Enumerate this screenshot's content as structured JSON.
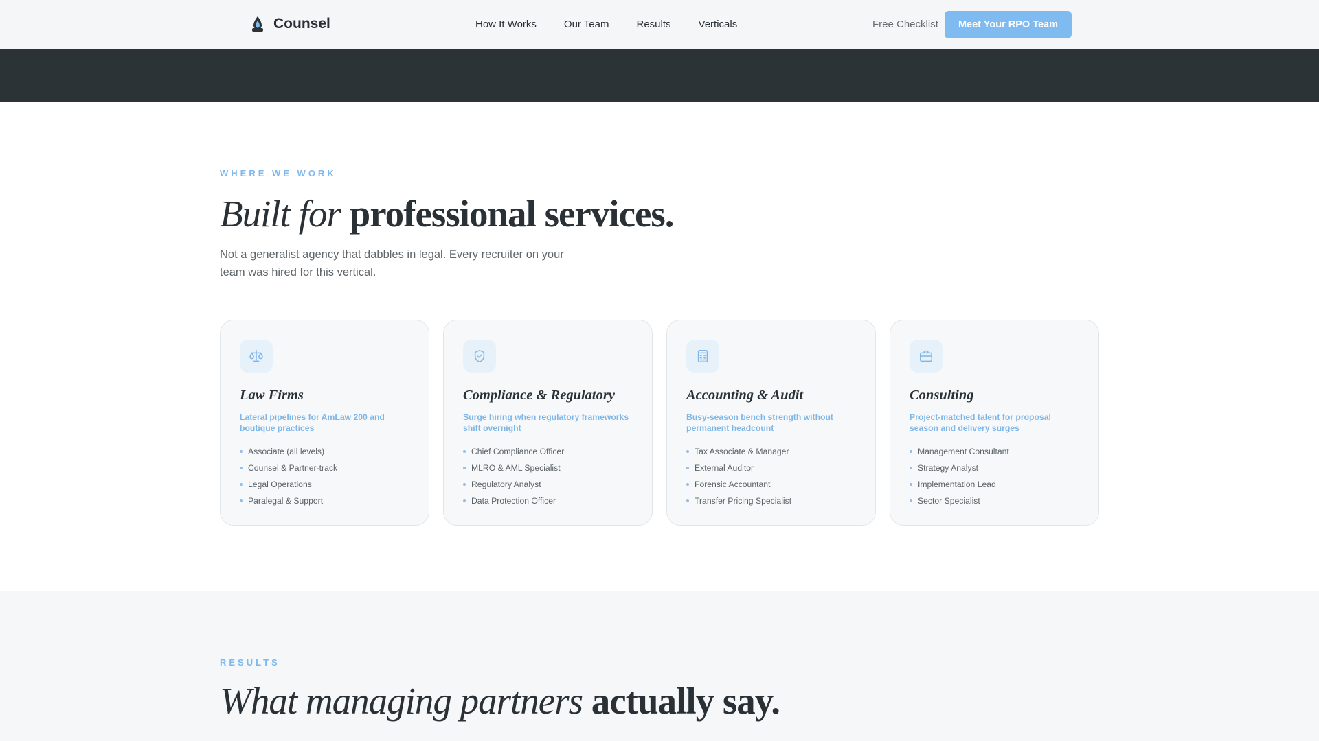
{
  "nav": {
    "logo": "Counsel",
    "links": [
      "How It Works",
      "Our Team",
      "Results",
      "Verticals"
    ],
    "checklist": "Free Checklist",
    "cta": "Meet Your RPO Team"
  },
  "colors": {
    "accent": "#7fbaf1",
    "dark_band": "#2c3337",
    "text": "#2a3136"
  },
  "where": {
    "eyebrow": "WHERE WE WORK",
    "title_italic": "Built for",
    "title_bold": "professional services.",
    "intro": "Not a generalist agency that dabbles in legal. Every recruiter on your team was hired for this vertical."
  },
  "cards": [
    {
      "icon": "scales-icon",
      "title": "Law Firms",
      "subtitle": "Lateral pipelines for AmLaw 200 and boutique practices",
      "items": [
        "Associate (all levels)",
        "Counsel & Partner-track",
        "Legal Operations",
        "Paralegal & Support"
      ]
    },
    {
      "icon": "shield-check-icon",
      "title": "Compliance & Regulatory",
      "subtitle": "Surge hiring when regulatory frameworks shift overnight",
      "items": [
        "Chief Compliance Officer",
        "MLRO & AML Specialist",
        "Regulatory Analyst",
        "Data Protection Officer"
      ]
    },
    {
      "icon": "calculator-icon",
      "title": "Accounting & Audit",
      "subtitle": "Busy-season bench strength without permanent headcount",
      "items": [
        "Tax Associate & Manager",
        "External Auditor",
        "Forensic Accountant",
        "Transfer Pricing Specialist"
      ]
    },
    {
      "icon": "briefcase-icon",
      "title": "Consulting",
      "subtitle": "Project-matched talent for proposal season and delivery surges",
      "items": [
        "Management Consultant",
        "Strategy Analyst",
        "Implementation Lead",
        "Sector Specialist"
      ]
    }
  ],
  "results": {
    "eyebrow": "RESULTS",
    "title_italic": "What managing partners",
    "title_bold": "actually say."
  }
}
